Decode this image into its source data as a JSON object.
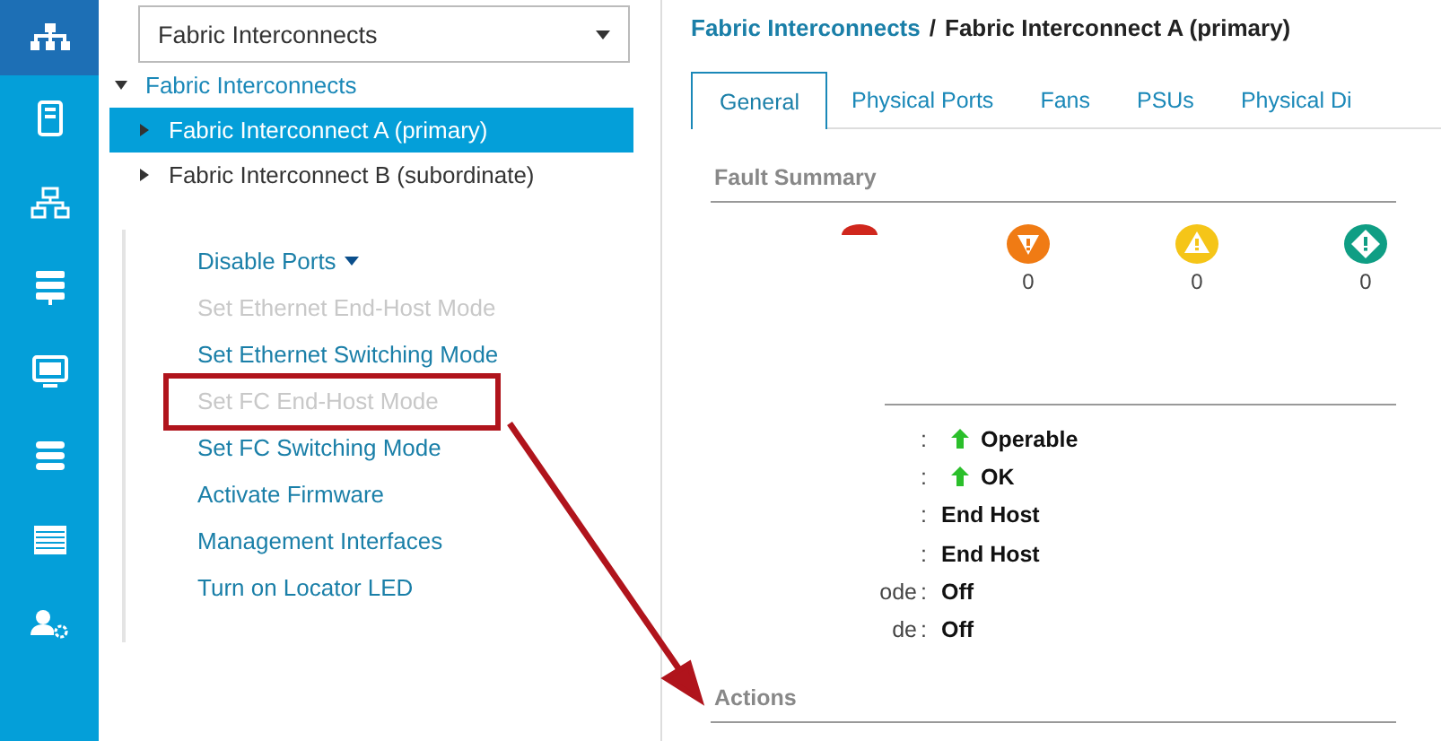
{
  "nav": [
    {
      "kind": "hierarchy",
      "selected": true
    },
    {
      "kind": "server",
      "selected": false
    },
    {
      "kind": "network",
      "selected": false
    },
    {
      "kind": "storage",
      "selected": false
    },
    {
      "kind": "monitor",
      "selected": false
    },
    {
      "kind": "stack",
      "selected": false
    },
    {
      "kind": "list",
      "selected": false
    },
    {
      "kind": "admin",
      "selected": false
    }
  ],
  "dropdown": {
    "value": "Fabric Interconnects"
  },
  "tree": [
    {
      "label": "Fabric Interconnects",
      "expanded": true,
      "selected": false,
      "children": [
        {
          "label": "Fabric Interconnect A (primary)",
          "expanded": false,
          "selected": true
        },
        {
          "label": "Fabric Interconnect B (subordinate)",
          "expanded": false,
          "selected": false
        }
      ]
    }
  ],
  "menu": [
    {
      "label": "Disable Ports",
      "kind": "submenu",
      "disabled": false,
      "highlighted": false
    },
    {
      "label": "Set Ethernet End-Host Mode",
      "kind": "action",
      "disabled": true,
      "highlighted": false
    },
    {
      "label": "Set Ethernet Switching Mode",
      "kind": "action",
      "disabled": false,
      "highlighted": false
    },
    {
      "label": "Set FC End-Host Mode",
      "kind": "action",
      "disabled": true,
      "highlighted": true
    },
    {
      "label": "Set FC Switching Mode",
      "kind": "action",
      "disabled": false,
      "highlighted": false
    },
    {
      "label": "Activate Firmware",
      "kind": "action",
      "disabled": false,
      "highlighted": false
    },
    {
      "label": "Management Interfaces",
      "kind": "action",
      "disabled": false,
      "highlighted": false
    },
    {
      "label": "Turn on Locator LED",
      "kind": "action",
      "disabled": false,
      "highlighted": false
    }
  ],
  "breadcrumb": {
    "parent": "Fabric Interconnects",
    "separator": "/",
    "current": "Fabric Interconnect A (primary)"
  },
  "tabs": [
    {
      "label": "General",
      "selected": true
    },
    {
      "label": "Physical Ports",
      "selected": false
    },
    {
      "label": "Fans",
      "selected": false
    },
    {
      "label": "PSUs",
      "selected": false
    },
    {
      "label": "Physical Di",
      "selected": false
    }
  ],
  "fault_summary": {
    "title": "Fault Summary",
    "faults": [
      {
        "kind": "critical"
      },
      {
        "kind": "major",
        "count": "0"
      },
      {
        "kind": "minor",
        "count": "0"
      },
      {
        "kind": "warning",
        "count": "0"
      }
    ]
  },
  "status": [
    {
      "colon": ":",
      "value": "Operable",
      "arrow": true
    },
    {
      "colon": ":",
      "value": "OK",
      "arrow": true
    },
    {
      "colon": ":",
      "value": "End Host",
      "arrow": false
    },
    {
      "colon": ":",
      "value": "End Host",
      "arrow": false
    },
    {
      "label": "ode",
      "colon": ":",
      "value": "Off",
      "arrow": false
    },
    {
      "label": "de",
      "colon": ":",
      "value": "Off",
      "arrow": false
    }
  ],
  "actions": {
    "title": "Actions"
  }
}
